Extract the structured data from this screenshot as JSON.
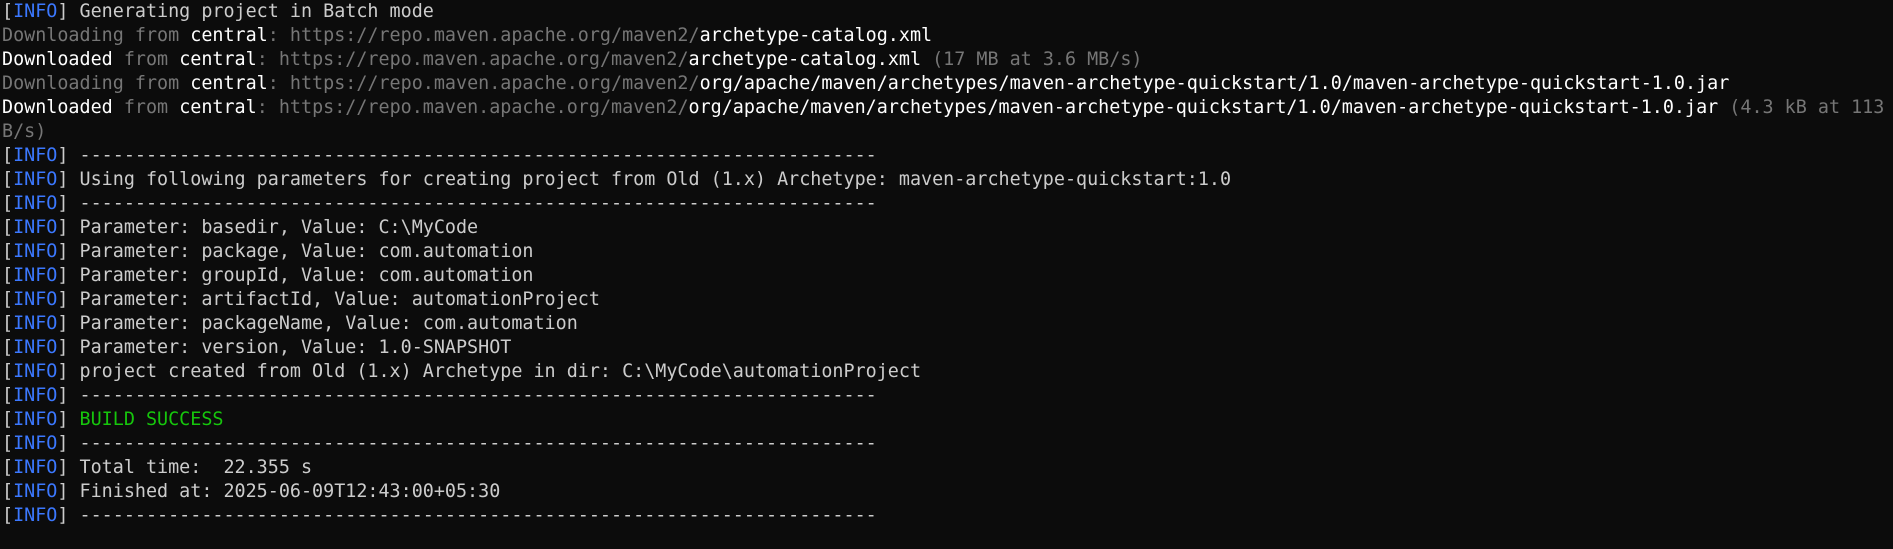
{
  "colors": {
    "background": "#0c0c0c",
    "default_text": "#cccccc",
    "info_tag": "#3b78ff",
    "dim_text": "#767676",
    "bright_text": "#ffffff",
    "success": "#16c60c"
  },
  "terminal": {
    "info_label": "INFO",
    "lines": [
      {
        "kind": "info",
        "text": "Generating project in Batch mode"
      },
      {
        "kind": "download",
        "verb": "Downloading",
        "from": "from",
        "repo": "central",
        "base": ": https://repo.maven.apache.org/maven2/",
        "file": "archetype-catalog.xml",
        "size": ""
      },
      {
        "kind": "download",
        "verb": "Downloaded",
        "from": "from",
        "repo": "central",
        "base": ": https://repo.maven.apache.org/maven2/",
        "file": "archetype-catalog.xml",
        "size": " (17 MB at 3.6 MB/s)"
      },
      {
        "kind": "download",
        "verb": "Downloading",
        "from": "from",
        "repo": "central",
        "base": ": https://repo.maven.apache.org/maven2/",
        "file": "org/apache/maven/archetypes/maven-archetype-quickstart/1.0/maven-archetype-quickstart-1.0.jar",
        "size": ""
      },
      {
        "kind": "download",
        "verb": "Downloaded",
        "from": "from",
        "repo": "central",
        "base": ": https://repo.maven.apache.org/maven2/",
        "file": "org/apache/maven/archetypes/maven-archetype-quickstart/1.0/maven-archetype-quickstart-1.0.jar",
        "size": " (4.3 kB at 113 k"
      },
      {
        "kind": "wrap",
        "text": "B/s)"
      },
      {
        "kind": "info",
        "text": "------------------------------------------------------------------------"
      },
      {
        "kind": "info",
        "text": "Using following parameters for creating project from Old (1.x) Archetype: maven-archetype-quickstart:1.0"
      },
      {
        "kind": "info",
        "text": "------------------------------------------------------------------------"
      },
      {
        "kind": "info",
        "text": "Parameter: basedir, Value: C:\\MyCode"
      },
      {
        "kind": "info",
        "text": "Parameter: package, Value: com.automation"
      },
      {
        "kind": "info",
        "text": "Parameter: groupId, Value: com.automation"
      },
      {
        "kind": "info",
        "text": "Parameter: artifactId, Value: automationProject"
      },
      {
        "kind": "info",
        "text": "Parameter: packageName, Value: com.automation"
      },
      {
        "kind": "info",
        "text": "Parameter: version, Value: 1.0-SNAPSHOT"
      },
      {
        "kind": "info",
        "text": "project created from Old (1.x) Archetype in dir: C:\\MyCode\\automationProject"
      },
      {
        "kind": "info",
        "text": "------------------------------------------------------------------------"
      },
      {
        "kind": "success",
        "text": "BUILD SUCCESS"
      },
      {
        "kind": "info",
        "text": "------------------------------------------------------------------------"
      },
      {
        "kind": "info",
        "text": "Total time:  22.355 s"
      },
      {
        "kind": "info",
        "text": "Finished at: 2025-06-09T12:43:00+05:30"
      },
      {
        "kind": "info",
        "text": "------------------------------------------------------------------------"
      }
    ]
  }
}
